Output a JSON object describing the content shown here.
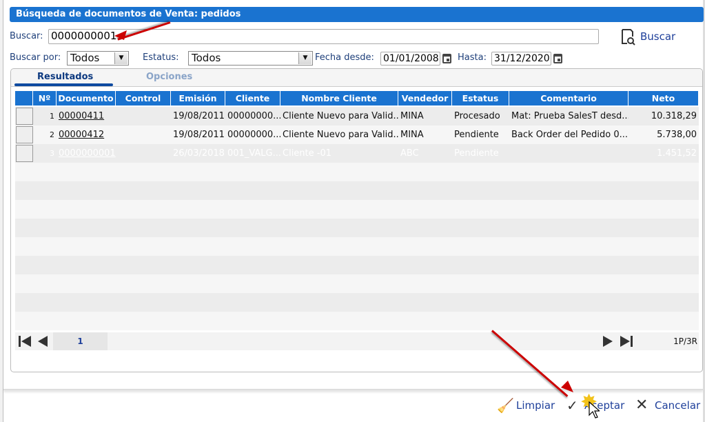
{
  "dialog": {
    "title": "Búsqueda de documentos de Venta: pedidos"
  },
  "search": {
    "label": "Buscar:",
    "value": "0000000001",
    "button": "Buscar"
  },
  "filters": {
    "buscar_por_label": "Buscar por:",
    "buscar_por_value": "Todos",
    "estatus_label": "Estatus:",
    "estatus_value": "Todos",
    "fecha_desde_label": "Fecha desde:",
    "fecha_desde_value": "01/01/2008",
    "hasta_label": "Hasta:",
    "hasta_value": "31/12/2020"
  },
  "tabs": [
    {
      "label": "Resultados",
      "active": true
    },
    {
      "label": "Opciones",
      "active": false
    }
  ],
  "table": {
    "columns": [
      "Nº",
      "Documento",
      "Control",
      "Emisión",
      "Cliente",
      "Nombre Cliente",
      "Vendedor",
      "Estatus",
      "Comentario",
      "Neto"
    ],
    "rows": [
      {
        "n": "1",
        "documento": "00000411",
        "control": "",
        "emision": "19/08/2011",
        "cliente": "00000000...",
        "nombre": "Cliente Nuevo para Valid...",
        "vendedor": "MINA",
        "estatus": "Procesado",
        "comentario": "Mat: Prueba SalesT desd...",
        "neto": "10.318,29"
      },
      {
        "n": "2",
        "documento": "00000412",
        "control": "",
        "emision": "19/08/2011",
        "cliente": "00000000...",
        "nombre": "Cliente Nuevo para Valid...",
        "vendedor": "MINA",
        "estatus": "Pendiente",
        "comentario": "Back Order del Pedido 0...",
        "neto": "5.738,00"
      },
      {
        "n": "3",
        "documento": "0000000001",
        "control": "",
        "emision": "26/03/2018",
        "cliente": "001_VALG...",
        "nombre": "Cliente -01",
        "vendedor": "ABC",
        "estatus": "Pendiente",
        "comentario": "",
        "neto": "1.451,52",
        "selected": true
      }
    ]
  },
  "pager": {
    "page": "1",
    "summary": "1P/3R"
  },
  "footer": {
    "limpiar": "Limpiar",
    "aceptar": "Aceptar",
    "cancelar": "Cancelar"
  },
  "colors": {
    "accent": "#1a73d0",
    "selected_row": "#0e4aa0",
    "arrow": "#cc0000"
  }
}
